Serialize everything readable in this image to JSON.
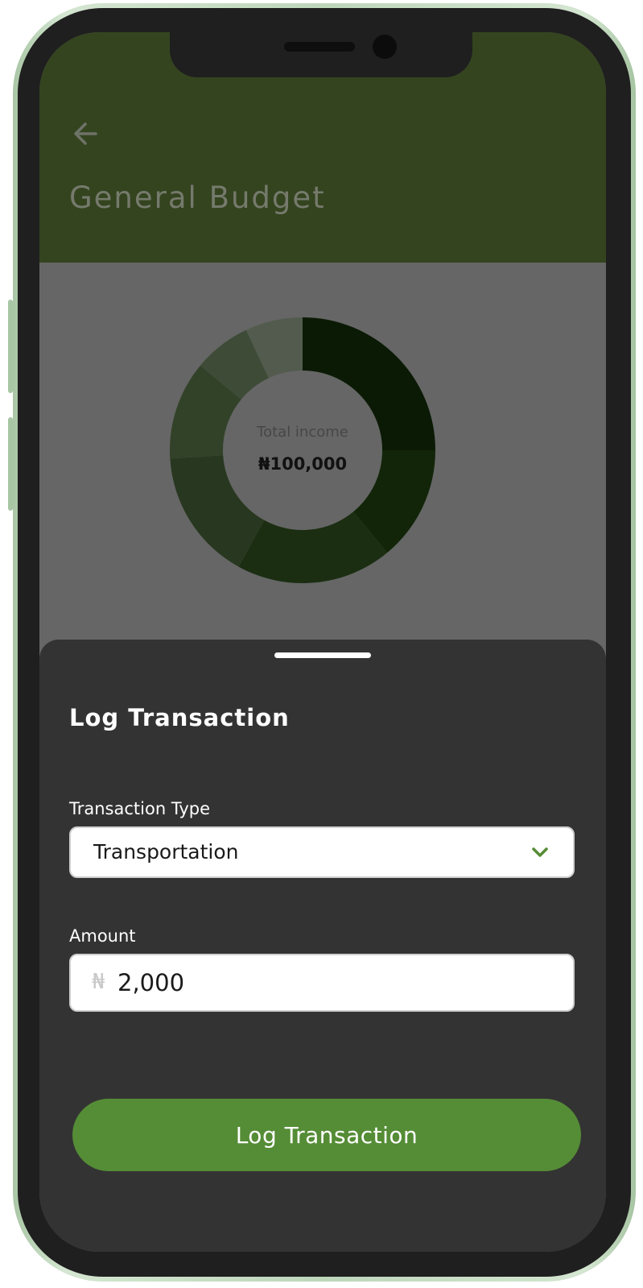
{
  "header": {
    "title": "General Budget",
    "back_icon": "arrow-left-icon",
    "background_color": "#34441f"
  },
  "chart_data": {
    "type": "pie",
    "center_label": "Total income",
    "center_value": "₦100,000",
    "slices": [
      {
        "value": 25,
        "color": "#0b1a05"
      },
      {
        "value": 14,
        "color": "#122509"
      },
      {
        "value": 19,
        "color": "#1b2e12"
      },
      {
        "value": 16,
        "color": "#283820"
      },
      {
        "value": 12,
        "color": "#324229"
      },
      {
        "value": 7,
        "color": "#3e4b37"
      },
      {
        "value": 7,
        "color": "#535b4e"
      }
    ]
  },
  "sheet": {
    "title": "Log Transaction",
    "transaction_type_label": "Transaction Type",
    "transaction_type_value": "Transportation",
    "dropdown_icon": "chevron-down-icon",
    "amount_label": "Amount",
    "currency_symbol": "₦",
    "amount_value": "2,000",
    "submit_label": "Log Transaction",
    "accent_color": "#558c36"
  }
}
